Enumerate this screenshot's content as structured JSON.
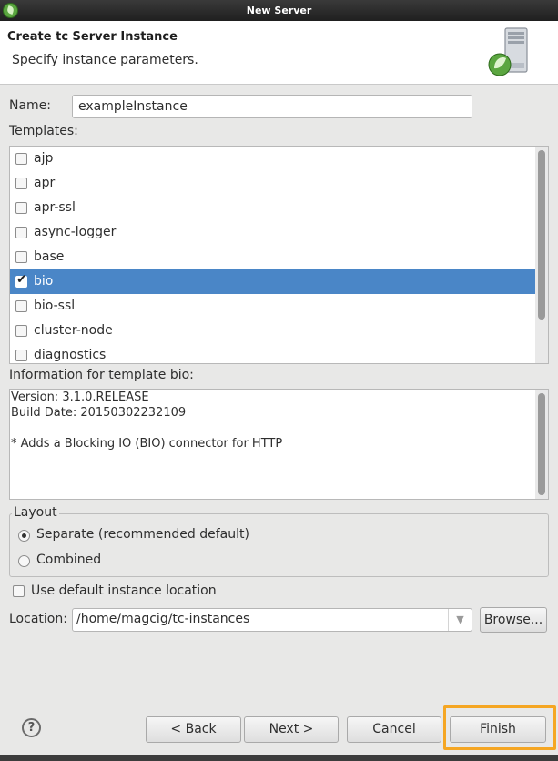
{
  "window": {
    "title": "New Server"
  },
  "banner": {
    "title": "Create tc Server Instance",
    "description": "Specify instance parameters."
  },
  "name_field": {
    "label": "Name:",
    "value": "exampleInstance"
  },
  "templates": {
    "label": "Templates:",
    "items": [
      {
        "label": "ajp",
        "checked": false
      },
      {
        "label": "apr",
        "checked": false
      },
      {
        "label": "apr-ssl",
        "checked": false
      },
      {
        "label": "async-logger",
        "checked": false
      },
      {
        "label": "base",
        "checked": false
      },
      {
        "label": "bio",
        "checked": true,
        "selected": true
      },
      {
        "label": "bio-ssl",
        "checked": false
      },
      {
        "label": "cluster-node",
        "checked": false
      },
      {
        "label": "diagnostics",
        "checked": false
      }
    ]
  },
  "info": {
    "label": "Information for template bio:",
    "lines": [
      "Version: 3.1.0.RELEASE",
      "Build Date: 20150302232109",
      "",
      "* Adds a Blocking IO (BIO) connector for HTTP"
    ]
  },
  "layout_group": {
    "title": "Layout",
    "options": [
      {
        "label": "Separate (recommended default)",
        "selected": true
      },
      {
        "label": "Combined",
        "selected": false
      }
    ]
  },
  "use_default_location": {
    "label": "Use default instance location",
    "checked": false
  },
  "location": {
    "label": "Location:",
    "value": "/home/magcig/tc-instances",
    "browse_label": "Browse..."
  },
  "buttons": {
    "back": "< Back",
    "next": "Next >",
    "cancel": "Cancel",
    "finish": "Finish"
  },
  "help_icon": {
    "glyph": "?"
  },
  "colors": {
    "selection": "#4a86c7",
    "highlight": "#f5a623",
    "titlebar": "#2b2b2b"
  }
}
